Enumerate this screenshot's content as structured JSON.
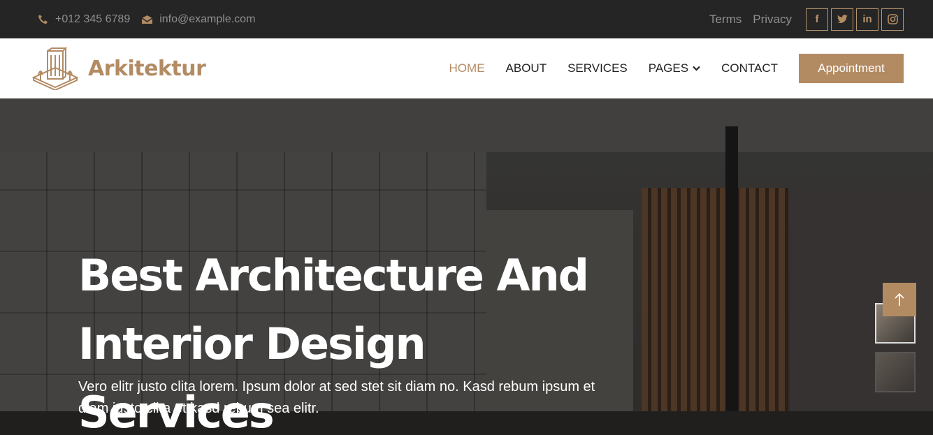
{
  "topbar": {
    "phone": "+012 345 6789",
    "email": "info@example.com",
    "links": [
      "Terms",
      "Privacy"
    ],
    "socials": [
      {
        "icon": "facebook-icon",
        "glyph": "f"
      },
      {
        "icon": "twitter-icon",
        "glyph": "t"
      },
      {
        "icon": "linkedin-icon",
        "glyph": "in"
      },
      {
        "icon": "instagram-icon",
        "glyph": "◎"
      }
    ]
  },
  "nav": {
    "brand": "Arkitektur",
    "items": [
      {
        "label": "HOME",
        "active": true
      },
      {
        "label": "ABOUT",
        "active": false
      },
      {
        "label": "SERVICES",
        "active": false
      },
      {
        "label": "PAGES",
        "active": false,
        "dropdown": true
      },
      {
        "label": "CONTACT",
        "active": false
      }
    ],
    "cta": "Appointment"
  },
  "hero": {
    "title_line1": "Best Architecture And",
    "title_line2": "Interior Design Services",
    "text": "Vero elitr justo clita lorem. Ipsum dolor at sed stet sit diam no. Kasd rebum ipsum et diam justo clita et kasd rebum sea elitr.",
    "back_to_top_icon": "arrow-up-icon"
  },
  "colors": {
    "accent": "#b38b63",
    "topbar_bg": "#252525",
    "nav_bg": "#ffffff"
  }
}
